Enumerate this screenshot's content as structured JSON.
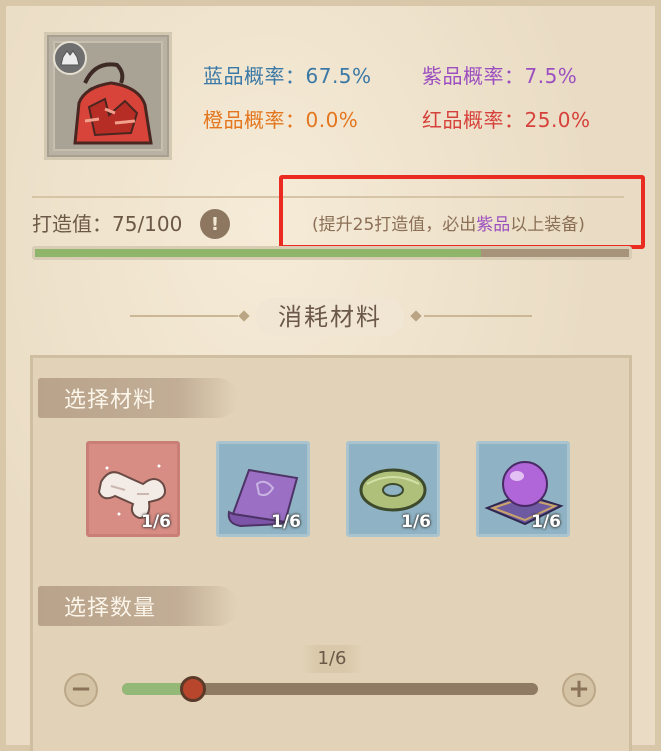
{
  "probabilities": {
    "blue": "蓝品概率：67.5%",
    "purple": "紫品概率：7.5%",
    "orange": "橙品概率：0.0%",
    "red": "红品概率：25.0%"
  },
  "forge": {
    "label": "打造值：75/100",
    "info_icon": "exclamation-icon",
    "hint_prefix": "(提升25打造值，必出",
    "hint_highlight": "紫品",
    "hint_suffix": "以上装备)",
    "progress": 0.75
  },
  "section_title": "消耗材料",
  "select_material": {
    "label": "选择材料",
    "materials": [
      {
        "name": "bone-material-icon",
        "count": "1/6",
        "bg": "red"
      },
      {
        "name": "purple-cloth-material-icon",
        "count": "1/6",
        "bg": "blue"
      },
      {
        "name": "jade-ring-material-icon",
        "count": "1/6",
        "bg": "blue"
      },
      {
        "name": "purple-orb-material-icon",
        "count": "1/6",
        "bg": "blue"
      }
    ]
  },
  "select_quantity": {
    "label": "选择数量",
    "value": "1/6",
    "fraction": 0.17,
    "minus": "−",
    "plus": "+"
  },
  "colors": {
    "blue": "#3a78a6",
    "purple": "#9b4fc0",
    "orange": "#e3761e",
    "red": "#d6423b",
    "highlight_box": "#ea2b22"
  }
}
